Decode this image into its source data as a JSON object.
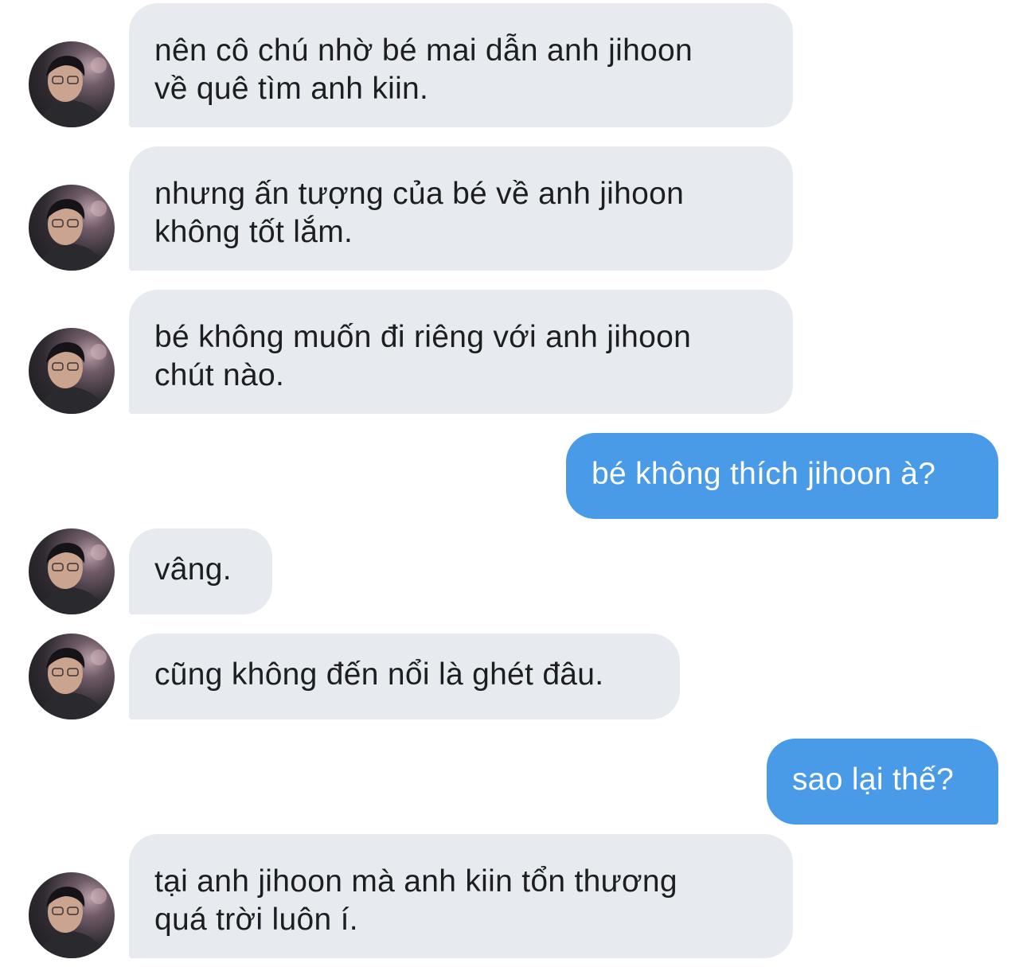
{
  "conversation": {
    "messages": [
      {
        "sender": "other",
        "text": "nên cô chú nhờ bé mai dẫn anh jihoon\nvề quê tìm anh kiin."
      },
      {
        "sender": "other",
        "text": "nhưng ấn tượng của bé về anh jihoon\nkhông tốt lắm."
      },
      {
        "sender": "other",
        "text": "bé không muốn đi riêng với anh jihoon\nchút nào."
      },
      {
        "sender": "me",
        "text": "bé không thích jihoon à?"
      },
      {
        "sender": "other",
        "text": "vâng."
      },
      {
        "sender": "other",
        "text": "cũng không đến nổi là ghét đâu."
      },
      {
        "sender": "me",
        "text": "sao lại thế?"
      },
      {
        "sender": "other",
        "text": "tại anh jihoon mà anh kiin tổn thương\nquá trời luôn í."
      }
    ]
  },
  "colors": {
    "incoming_bubble": "#e7ebef",
    "outgoing_bubble": "#4a9be7",
    "incoming_text": "#1c1e21",
    "outgoing_text": "#ffffff"
  }
}
